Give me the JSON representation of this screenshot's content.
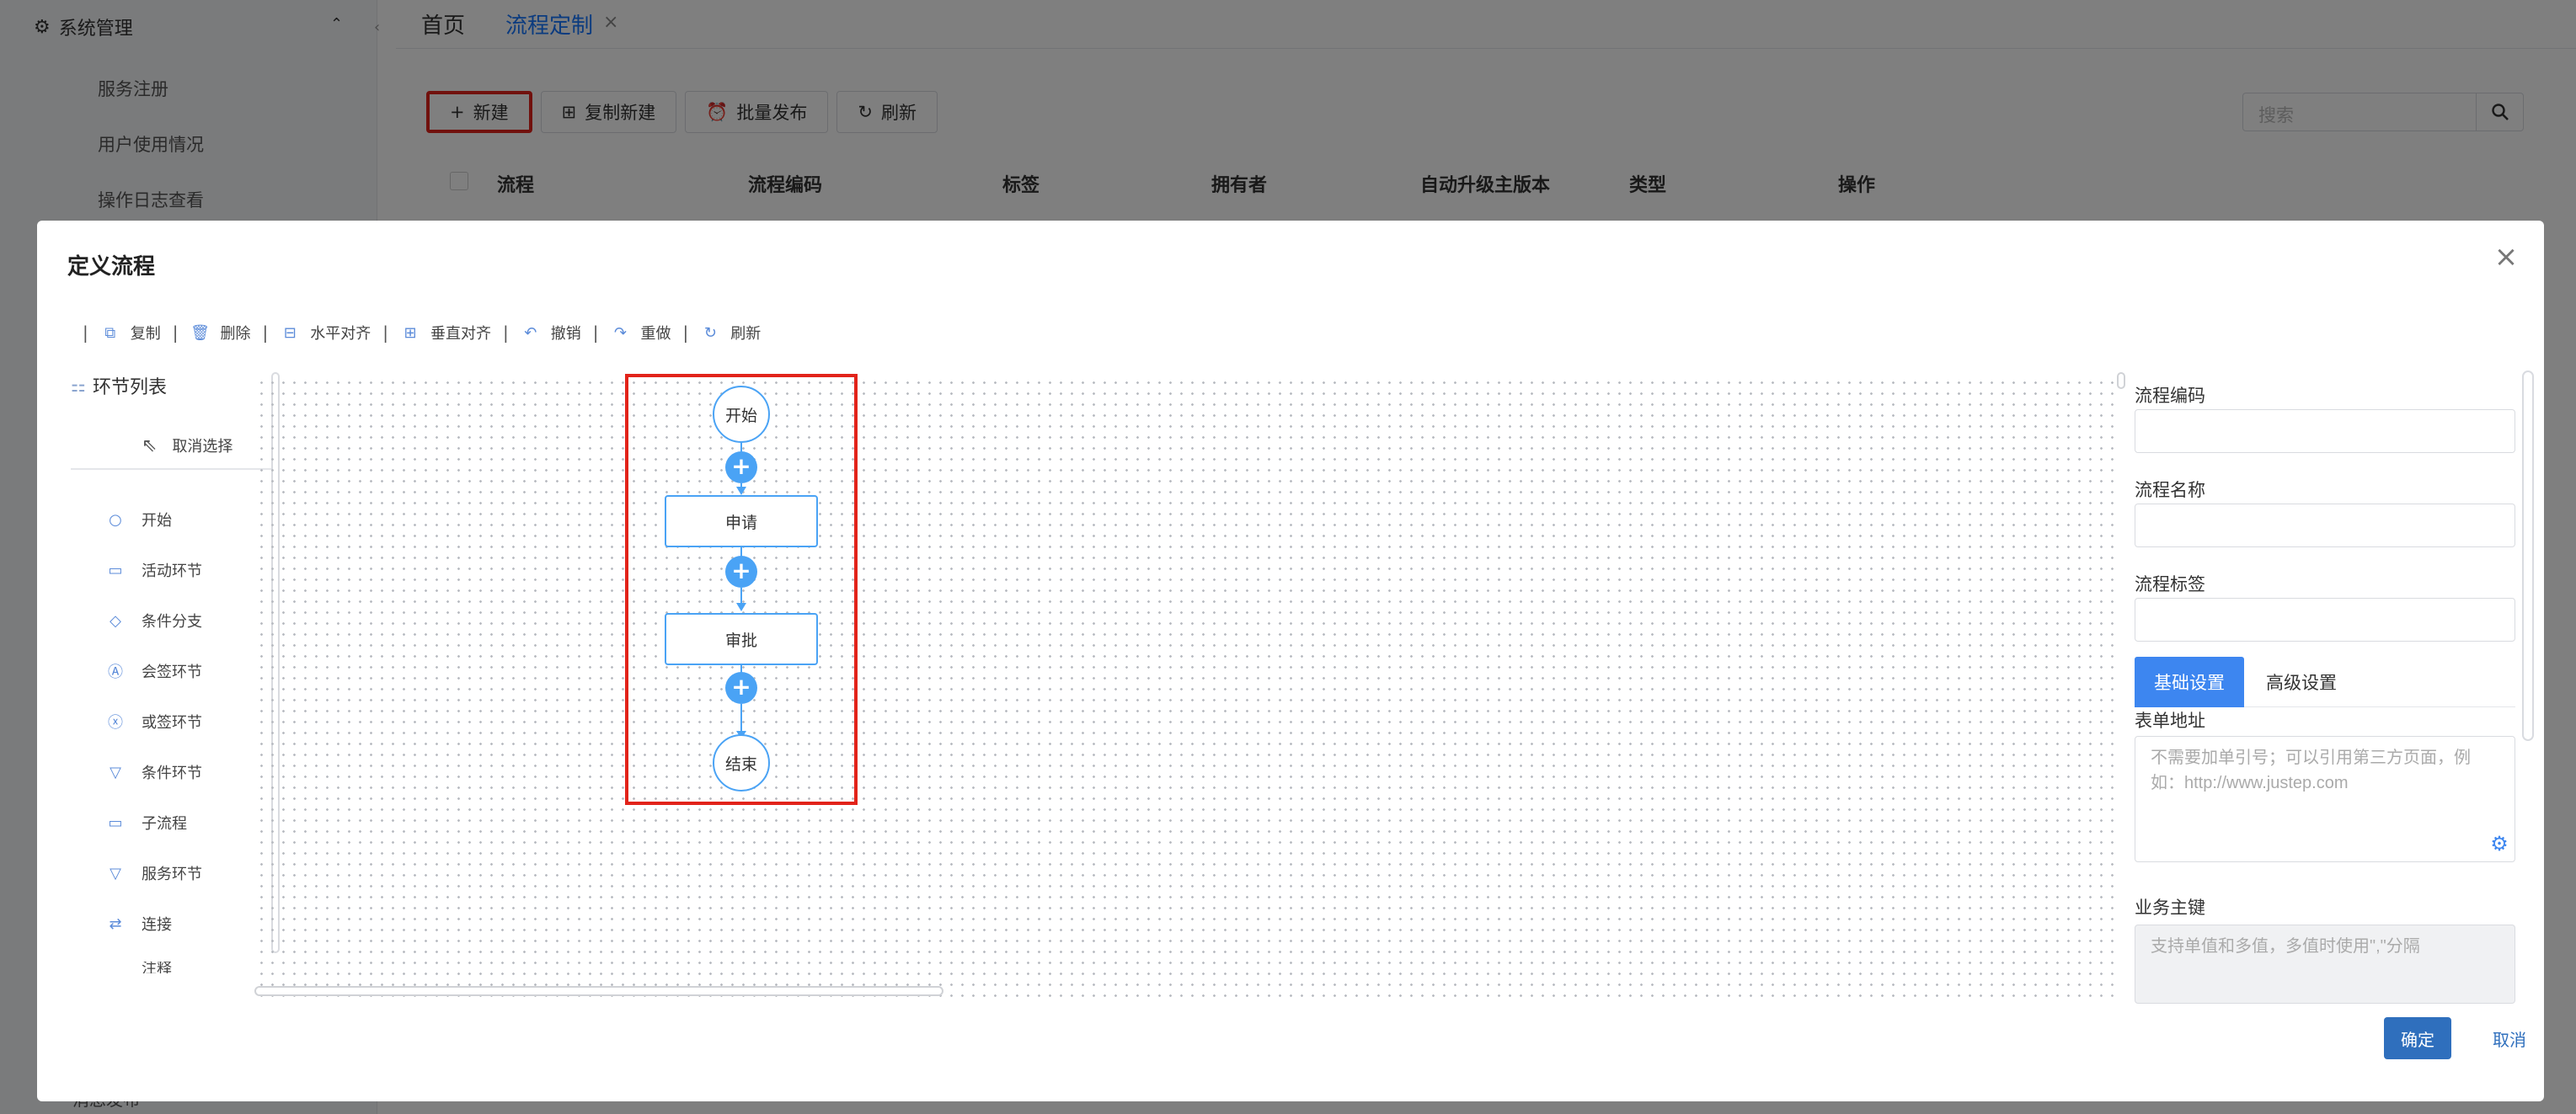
{
  "app": {
    "sidebar": {
      "section_title": "系统管理",
      "items": [
        "服务注册",
        "用户使用情况",
        "操作日志查看"
      ],
      "bottom_item": "消息发布"
    },
    "tabs": {
      "home": "首页",
      "active": "流程定制",
      "close": "×"
    },
    "toolbar": {
      "new": "新建",
      "copy_new": "复制新建",
      "batch_publish": "批量发布",
      "refresh": "刷新"
    },
    "search_placeholder": "搜索",
    "table_headers": [
      "流程",
      "流程编码",
      "标签",
      "拥有者",
      "自动升级主版本",
      "类型",
      "操作"
    ]
  },
  "modal": {
    "title": "定义流程",
    "close": "×",
    "toolbar": {
      "copy": "复制",
      "delete": "删除",
      "align_h": "水平对齐",
      "align_v": "垂直对齐",
      "undo": "撤销",
      "redo": "重做",
      "refresh": "刷新"
    },
    "palette": {
      "title": "环节列表",
      "cancel": "取消选择",
      "items": [
        "开始",
        "活动环节",
        "条件分支",
        "会签环节",
        "或签环节",
        "条件环节",
        "子流程",
        "服务环节",
        "连接",
        "注释"
      ]
    },
    "flow": {
      "start": "开始",
      "step1": "申请",
      "step2": "审批",
      "end": "结束",
      "plus": "+"
    },
    "props": {
      "code_label": "流程编码",
      "name_label": "流程名称",
      "tag_label": "流程标签",
      "tab_basic": "基础设置",
      "tab_advanced": "高级设置",
      "form_url_label": "表单地址",
      "form_url_placeholder": "不需要加单引号；可以引用第三方页面，例如：http://www.justep.com",
      "biz_key_label": "业务主键",
      "biz_key_placeholder": "支持单值和多值，多值时使用\",\"分隔"
    },
    "footer": {
      "ok": "确定",
      "cancel": "取消"
    }
  }
}
